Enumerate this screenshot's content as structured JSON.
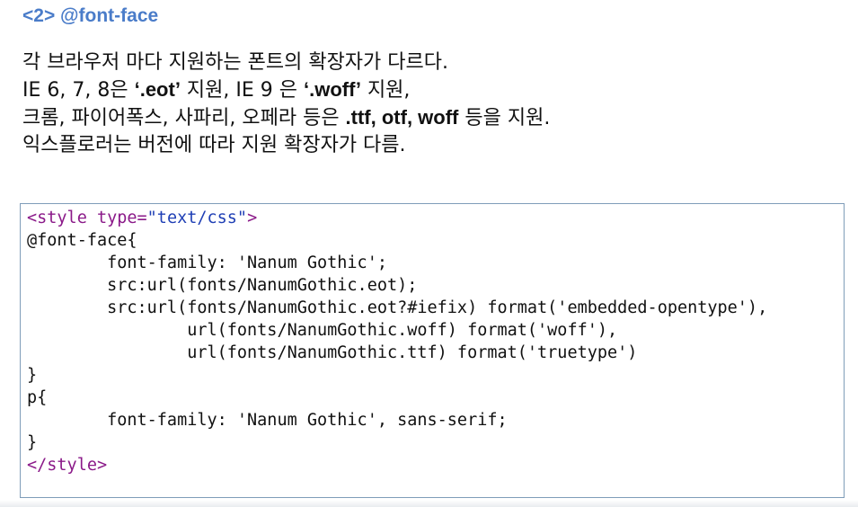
{
  "heading": "<2> @font-face",
  "description": {
    "line1": "각 브라우저 마다 지원하는 폰트의 확장자가 다르다.",
    "line2": {
      "a": "IE 6, 7, 8은 ",
      "b": "‘.eot’",
      "c": " 지원, IE 9 은 ",
      "d": "‘.woff’",
      "e": " 지원,"
    },
    "line3": {
      "a": "크롬, 파이어폭스, 사파리, 오페라 등은 ",
      "b": ".ttf, otf, woff",
      "c": " 등을 지원."
    },
    "line4": "익스플로러는 버전에 따라 지원 확장자가 다름."
  },
  "code": {
    "l1_tag_open": "<style ",
    "l1_attr": "type=",
    "l1_value": "\"text/css\"",
    "l1_tag_close": ">",
    "l2": "@font-face{",
    "l3": "        font-family: 'Nanum Gothic';",
    "l4": "        src:url(fonts/NanumGothic.eot);",
    "l5": "        src:url(fonts/NanumGothic.eot?#iefix) format('embedded-opentype'),",
    "l6": "                url(fonts/NanumGothic.woff) format('woff'),",
    "l7": "                url(fonts/NanumGothic.ttf) format('truetype')",
    "l8": "}",
    "l9": "p{",
    "l10": "        font-family: 'Nanum Gothic', sans-serif;",
    "l11": "}",
    "l12": "</style>"
  }
}
